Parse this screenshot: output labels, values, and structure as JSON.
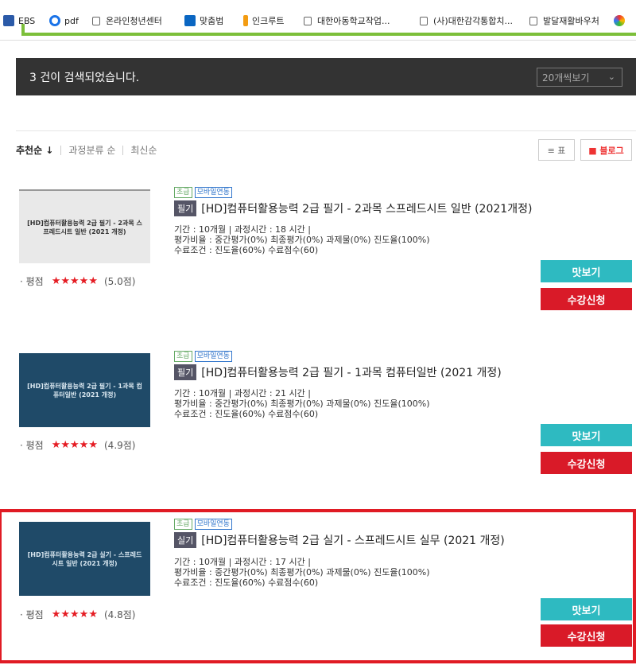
{
  "bookmarks": [
    {
      "label": "EBS",
      "icon": "ebs-icon",
      "color": "#2b5aa8"
    },
    {
      "label": "pdf",
      "icon": "pdf-icon",
      "color": "#1a73e8"
    },
    {
      "label": "온라인청년센터",
      "icon": "folder-icon"
    },
    {
      "label": "맞춤법",
      "icon": "linkedin-icon",
      "color": "#0a66c2"
    },
    {
      "label": "인크루트",
      "icon": "incruit-icon",
      "color": "#f39c12"
    },
    {
      "label": "대한아동학교작업...",
      "icon": "folder-icon"
    },
    {
      "label": "(사)대한감각통합치...",
      "icon": "folder-icon"
    },
    {
      "label": "발달재활바우처",
      "icon": "folder-icon"
    }
  ],
  "results": {
    "count_text": "3 건이 검색되었습니다.",
    "page_size_selected": "20개씩보기"
  },
  "sort": {
    "options": [
      "추천순 ↓",
      "과정분류 순",
      "최신순"
    ],
    "view_table": "≡ 표",
    "view_blog": "■ 블로그"
  },
  "courses": [
    {
      "thumb_text": "[HD]컴퓨터활용능력 2급 필기 - 2과목 스프레드시트 일반 (2021 개정)",
      "level": "초급",
      "mobile": "모바일연동",
      "type": "필기",
      "title": "[HD]컴퓨터활용능력 2급 필기 - 2과목 스프레드시트 일반 (2021개정)",
      "meta1": "기간 : 10개월  |  과정시간 : 18 시간  |",
      "meta2": "평가비율 : 중간평가(0%) 최종평가(0%) 과제물(0%) 진도율(100%)",
      "meta3": "수료조건 : 진도율(60%) 수료점수(60)",
      "rating_label": "· 평점",
      "rating_stars": "★★★★★",
      "rating_value": "(5.0점)",
      "preview": "맛보기",
      "apply": "수강신청"
    },
    {
      "thumb_text": "[HD]컴퓨터활용능력 2급 필기 - 1과목 컴퓨터일반 (2021 개정)",
      "level": "초급",
      "mobile": "모바일연동",
      "type": "필기",
      "title": "[HD]컴퓨터활용능력 2급 필기 - 1과목 컴퓨터일반 (2021 개정)",
      "meta1": "기간 : 10개월  |  과정시간 : 21 시간  |",
      "meta2": "평가비율 : 중간평가(0%) 최종평가(0%) 과제물(0%) 진도율(100%)",
      "meta3": "수료조건 : 진도율(60%) 수료점수(60)",
      "rating_label": "· 평점",
      "rating_stars": "★★★★★",
      "rating_value": "(4.9점)",
      "preview": "맛보기",
      "apply": "수강신청"
    },
    {
      "thumb_text": "[HD]컴퓨터활용능력 2급 실기 - 스프레드시트 일반 (2021 개정)",
      "level": "초급",
      "mobile": "모바일연동",
      "type": "실기",
      "title": "[HD]컴퓨터활용능력 2급 실기 - 스프레드시트 실무 (2021 개정)",
      "meta1": "기간 : 10개월  |  과정시간 : 17 시간  |",
      "meta2": "평가비율 : 중간평가(0%) 최종평가(0%) 과제물(0%) 진도율(100%)",
      "meta3": "수료조건 : 진도율(60%) 수료점수(60)",
      "rating_label": "· 평점",
      "rating_stars": "★★★★★",
      "rating_value": "(4.8점)",
      "preview": "맛보기",
      "apply": "수강신청"
    }
  ],
  "colors": {
    "accent_teal": "#2ebac1",
    "accent_red": "#d91a28",
    "highlight_border": "#e01b24",
    "result_bar": "#333333"
  }
}
